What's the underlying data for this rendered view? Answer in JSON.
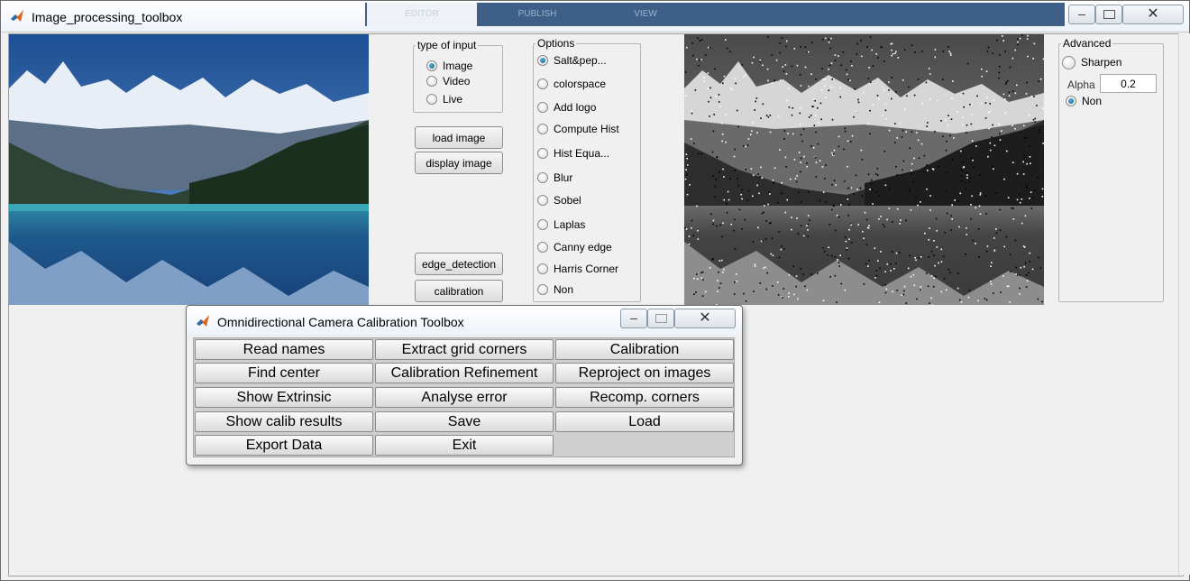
{
  "main_window": {
    "title": "Image_processing_toolbox",
    "bg_tabs": [
      "EDITOR",
      "PUBLISH",
      "VIEW"
    ]
  },
  "input_group": {
    "title": "type of input",
    "options": [
      "Image",
      "Video",
      "Live"
    ],
    "selected": "Image"
  },
  "buttons": {
    "load_image": "load image",
    "display_image": "display image",
    "edge_detection": "edge_detection",
    "calibration": "calibration"
  },
  "options_group": {
    "title": "Options",
    "options": [
      "Salt&pep...",
      "colorspace",
      "Add logo",
      "Compute Hist",
      "Hist Equa...",
      "Blur",
      "Sobel",
      "Laplas",
      "Canny edge",
      "Harris Corner",
      "Non"
    ],
    "selected": "Salt&pep..."
  },
  "advanced_group": {
    "title": "Advanced",
    "sharpen_label": "Sharpen",
    "alpha_label": "Alpha",
    "alpha_value": "0.2",
    "non_label": "Non",
    "selected": "Non"
  },
  "calib_window": {
    "title": "Omnidirectional Camera Calibration Toolbox",
    "buttons": [
      "Read names",
      "Extract grid corners",
      "Calibration",
      "Find center",
      "Calibration Refinement",
      "Reproject on images",
      "Show Extrinsic",
      "Analyse error",
      "Recomp. corners",
      "Show calib results",
      "Save",
      "Load",
      "Export Data",
      "Exit"
    ]
  },
  "colors": {
    "sky": "#2a5d9c",
    "lake": "#1b6f8a",
    "forest": "#1c3a22"
  }
}
